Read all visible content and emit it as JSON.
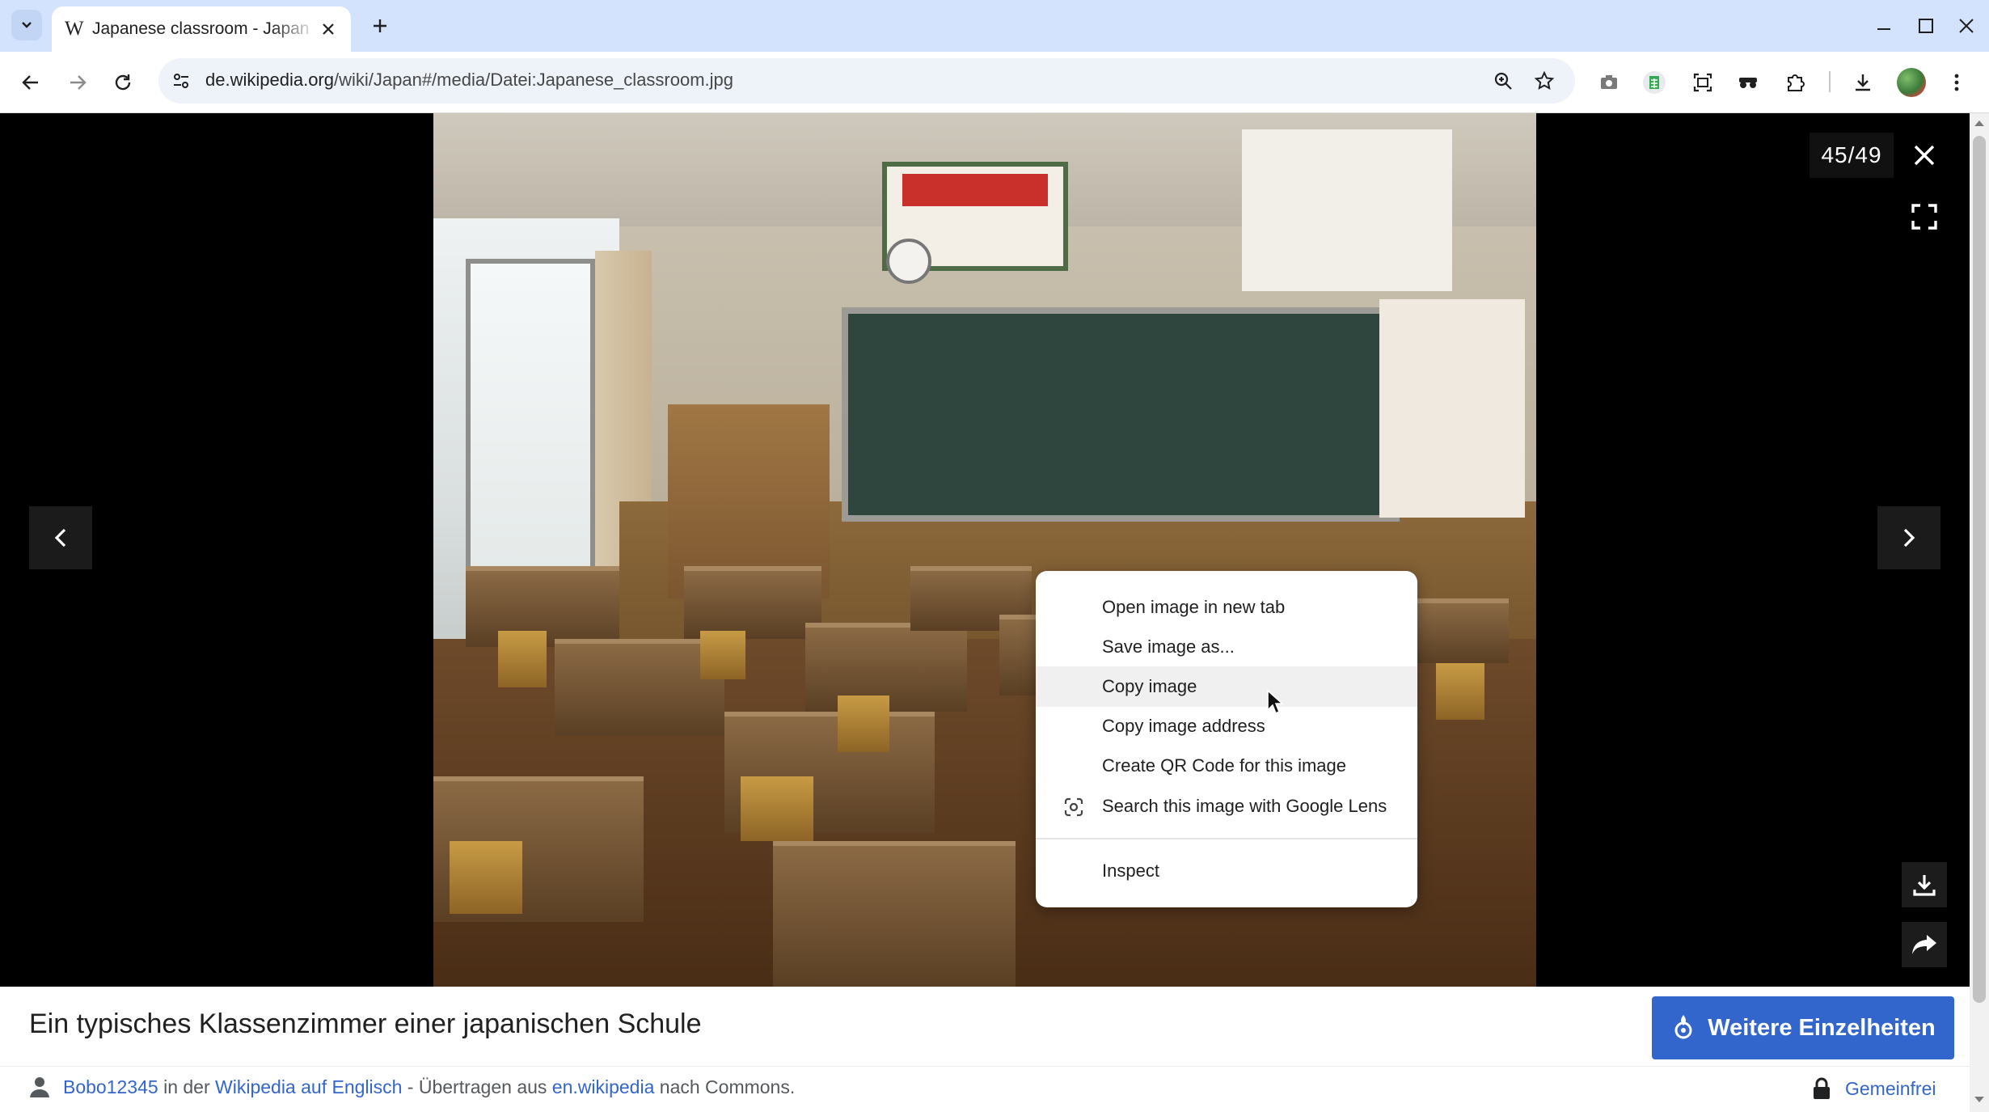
{
  "browser": {
    "tab": {
      "title": "Japanese classroom - Japan",
      "favicon": "W"
    },
    "url": {
      "domain": "de.wikipedia.org",
      "path": "/wiki/Japan#/media/Datei:Japanese_classroom.jpg"
    }
  },
  "viewer": {
    "counter": "45/49",
    "caption": "Ein typisches Klassenzimmer einer japanischen Schule",
    "details_button": "Weitere Einzelheiten",
    "credit": {
      "author": "Bobo12345",
      "t1": " in der ",
      "source": "Wikipedia auf Englisch",
      "t2": " - Übertragen aus ",
      "source2": "en.wikipedia",
      "t3": " nach Commons."
    },
    "license": "Gemeinfrei"
  },
  "context_menu": {
    "items": [
      "Open image in new tab",
      "Save image as...",
      "Copy image",
      "Copy image address",
      "Create QR Code for this image",
      "Search this image with Google Lens",
      "Inspect"
    ],
    "hovered": "Copy image"
  },
  "colors": {
    "tabstrip": "#d3e3fd",
    "accent_blue": "#3366cc",
    "viewer_bg": "#000000"
  }
}
